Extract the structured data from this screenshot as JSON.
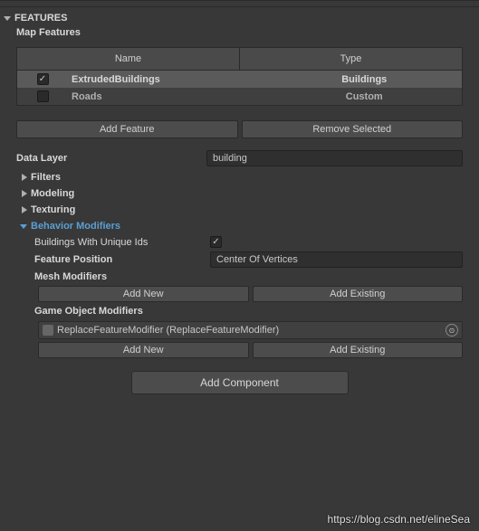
{
  "section": {
    "title": "FEATURES",
    "subtitle": "Map Features"
  },
  "table": {
    "headers": {
      "name": "Name",
      "type": "Type"
    },
    "rows": [
      {
        "checked": true,
        "name": "ExtrudedBuildings",
        "type": "Buildings"
      },
      {
        "checked": false,
        "name": "Roads",
        "type": "Custom"
      }
    ]
  },
  "buttons": {
    "add_feature": "Add Feature",
    "remove_selected": "Remove Selected"
  },
  "data_layer": {
    "label": "Data Layer",
    "value": "building"
  },
  "groups": {
    "filters": "Filters",
    "modeling": "Modeling",
    "texturing": "Texturing",
    "behavior": "Behavior Modifiers"
  },
  "behavior": {
    "unique_ids": {
      "label": "Buildings With Unique Ids",
      "checked": true
    },
    "feature_position": {
      "label": "Feature Position",
      "value": "Center Of Vertices"
    },
    "mesh_modifiers": {
      "label": "Mesh Modifiers",
      "add_new": "Add New",
      "add_existing": "Add Existing"
    },
    "gameobject_modifiers": {
      "label": "Game Object Modifiers",
      "item": "ReplaceFeatureModifier (ReplaceFeatureModifier)",
      "add_new": "Add New",
      "add_existing": "Add Existing"
    }
  },
  "add_component": "Add Component",
  "watermark": "https://blog.csdn.net/elineSea"
}
